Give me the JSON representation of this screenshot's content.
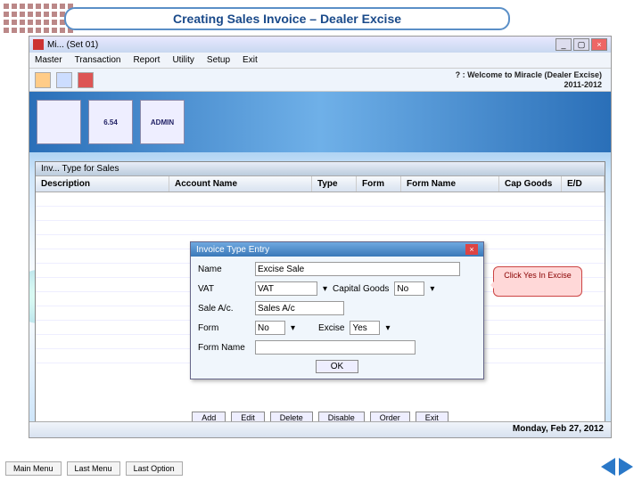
{
  "slide": {
    "title": "Creating Sales Invoice – Dealer Excise"
  },
  "window": {
    "title": "Mi... (Set 01)",
    "welcome_line1": "? : Welcome to Miracle (Dealer Excise)",
    "welcome_line2": "2011-2012",
    "status_date": "Monday, Feb 27, 2012"
  },
  "menu": {
    "master": "Master",
    "transaction": "Transaction",
    "report": "Report",
    "utility": "Utility",
    "setup": "Setup",
    "exit": "Exit"
  },
  "banner": {
    "tile1": "",
    "tile2": "6.54",
    "tile3": "ADMIN"
  },
  "invlist": {
    "title": "Inv... Type for Sales",
    "cols": {
      "desc": "Description",
      "acc": "Account Name",
      "type": "Type",
      "form": "Form",
      "fname": "Form Name",
      "cap": "Cap Goods",
      "ed": "E/D"
    },
    "btns": {
      "add": "Add",
      "edit": "Edit",
      "delete": "Delete",
      "disable": "Disable",
      "order": "Order",
      "exit": "Exit"
    }
  },
  "dialog": {
    "title": "Invoice Type Entry",
    "labels": {
      "name": "Name",
      "vat": "VAT",
      "sale": "Sale A/c.",
      "form": "Form",
      "fname": "Form Name",
      "capg": "Capital Goods",
      "exc": "Excise"
    },
    "values": {
      "name": "Excise Sale",
      "vat": "VAT",
      "sale": "Sales A/c",
      "form": "No",
      "capg": "No",
      "exc": "Yes",
      "fname": ""
    },
    "ok": "OK"
  },
  "callout": {
    "text": "Click Yes In Excise"
  },
  "footer": {
    "main": "Main Menu",
    "last_menu": "Last Menu",
    "last_opt": "Last Option"
  }
}
